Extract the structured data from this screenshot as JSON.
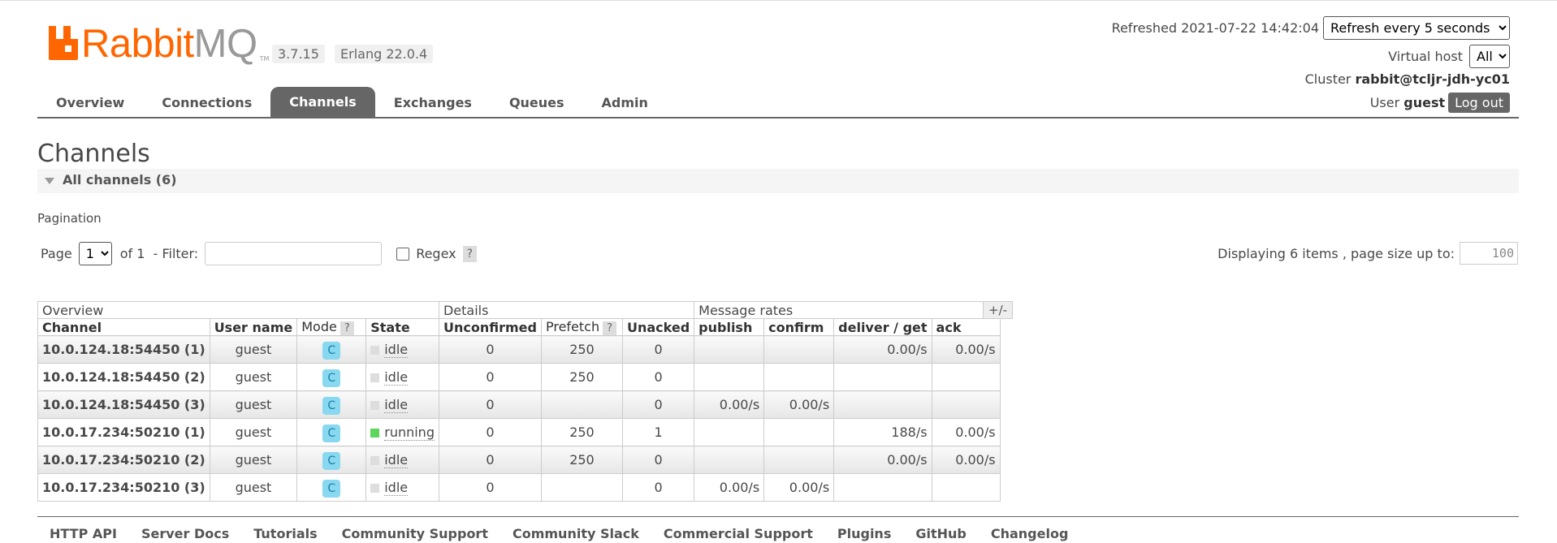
{
  "header": {
    "logo_rabbit": "Rabbit",
    "logo_mq": "MQ",
    "logo_tm": "TM",
    "version_badge": "3.7.15",
    "erlang_badge": "Erlang 22.0.4",
    "refreshed_label": "Refreshed 2021-07-22 14:42:04",
    "refresh_select": "Refresh every 5 seconds",
    "vhost_label": "Virtual host",
    "vhost_select": "All",
    "cluster_label": "Cluster",
    "cluster_name": "rabbit@tcljr-jdh-yc01",
    "user_label": "User",
    "user_name": "guest",
    "logout_label": "Log out"
  },
  "tabs": [
    "Overview",
    "Connections",
    "Channels",
    "Exchanges",
    "Queues",
    "Admin"
  ],
  "active_tab": "Channels",
  "page_title": "Channels",
  "section": {
    "title": "All channels (6)"
  },
  "pagination": {
    "label": "Pagination",
    "page_label": "Page",
    "page_value": "1",
    "of_label": "of 1",
    "filter_label": "- Filter:",
    "filter_value": "",
    "regex_label": "Regex",
    "help_label": "?",
    "displaying_prefix": "Displaying",
    "displaying_count": "6",
    "displaying_suffix": "items , page size up to:",
    "page_size": "100"
  },
  "table": {
    "groups": [
      "Overview",
      "Details",
      "Message rates"
    ],
    "columns": [
      "Channel",
      "User name",
      "Mode",
      "State",
      "Unconfirmed",
      "Prefetch",
      "Unacked",
      "publish",
      "confirm",
      "deliver / get",
      "ack"
    ],
    "plus_minus": "+/-",
    "rows": [
      {
        "channel": "10.0.124.18:54450 (1)",
        "user": "guest",
        "mode": "C",
        "state": "idle",
        "unconfirmed": "0",
        "prefetch": "250",
        "unacked": "0",
        "publish": "",
        "confirm": "",
        "deliver": "0.00/s",
        "ack": "0.00/s"
      },
      {
        "channel": "10.0.124.18:54450 (2)",
        "user": "guest",
        "mode": "C",
        "state": "idle",
        "unconfirmed": "0",
        "prefetch": "250",
        "unacked": "0",
        "publish": "",
        "confirm": "",
        "deliver": "",
        "ack": ""
      },
      {
        "channel": "10.0.124.18:54450 (3)",
        "user": "guest",
        "mode": "C",
        "state": "idle",
        "unconfirmed": "0",
        "prefetch": "",
        "unacked": "0",
        "publish": "0.00/s",
        "confirm": "0.00/s",
        "deliver": "",
        "ack": ""
      },
      {
        "channel": "10.0.17.234:50210 (1)",
        "user": "guest",
        "mode": "C",
        "state": "running",
        "unconfirmed": "0",
        "prefetch": "250",
        "unacked": "1",
        "publish": "",
        "confirm": "",
        "deliver": "188/s",
        "ack": "0.00/s"
      },
      {
        "channel": "10.0.17.234:50210 (2)",
        "user": "guest",
        "mode": "C",
        "state": "idle",
        "unconfirmed": "0",
        "prefetch": "250",
        "unacked": "0",
        "publish": "",
        "confirm": "",
        "deliver": "0.00/s",
        "ack": "0.00/s"
      },
      {
        "channel": "10.0.17.234:50210 (3)",
        "user": "guest",
        "mode": "C",
        "state": "idle",
        "unconfirmed": "0",
        "prefetch": "",
        "unacked": "0",
        "publish": "0.00/s",
        "confirm": "0.00/s",
        "deliver": "",
        "ack": ""
      }
    ]
  },
  "footer": [
    "HTTP API",
    "Server Docs",
    "Tutorials",
    "Community Support",
    "Community Slack",
    "Commercial Support",
    "Plugins",
    "GitHub",
    "Changelog"
  ],
  "colors": {
    "accent": "#ff6600",
    "tab_active": "#666666",
    "mode_badge": "#88d8f0",
    "running": "#5dd55d",
    "idle": "#dddddd"
  }
}
